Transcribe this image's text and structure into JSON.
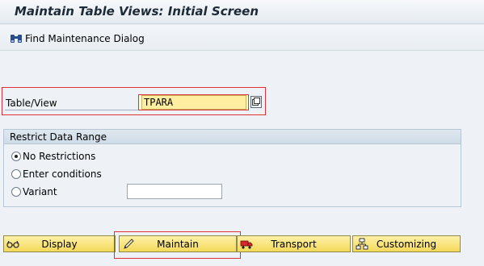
{
  "window": {
    "title": "Maintain Table Views: Initial Screen"
  },
  "toolbar": {
    "find_dialog_label": "Find Maintenance Dialog",
    "find_dialog_icon": "binoculars-icon"
  },
  "table_view": {
    "label": "Table/View",
    "value": "TPARA",
    "help_icon": "value-help-icon"
  },
  "restrict": {
    "title": "Restrict Data Range",
    "options": [
      {
        "label": "No Restrictions",
        "selected": true
      },
      {
        "label": "Enter conditions",
        "selected": false
      },
      {
        "label": "Variant",
        "selected": false
      }
    ],
    "variant_value": ""
  },
  "actions": {
    "display": {
      "label": "Display",
      "icon": "glasses-icon"
    },
    "maintain": {
      "label": "Maintain",
      "icon": "pencil-icon"
    },
    "transport": {
      "label": "Transport",
      "icon": "truck-icon"
    },
    "customizing": {
      "label": "Customizing",
      "icon": "hierarchy-icon"
    }
  },
  "colors": {
    "highlight": "#e0303a",
    "button_yellow": "#f3d95a",
    "input_yellow": "#ffeda0"
  }
}
